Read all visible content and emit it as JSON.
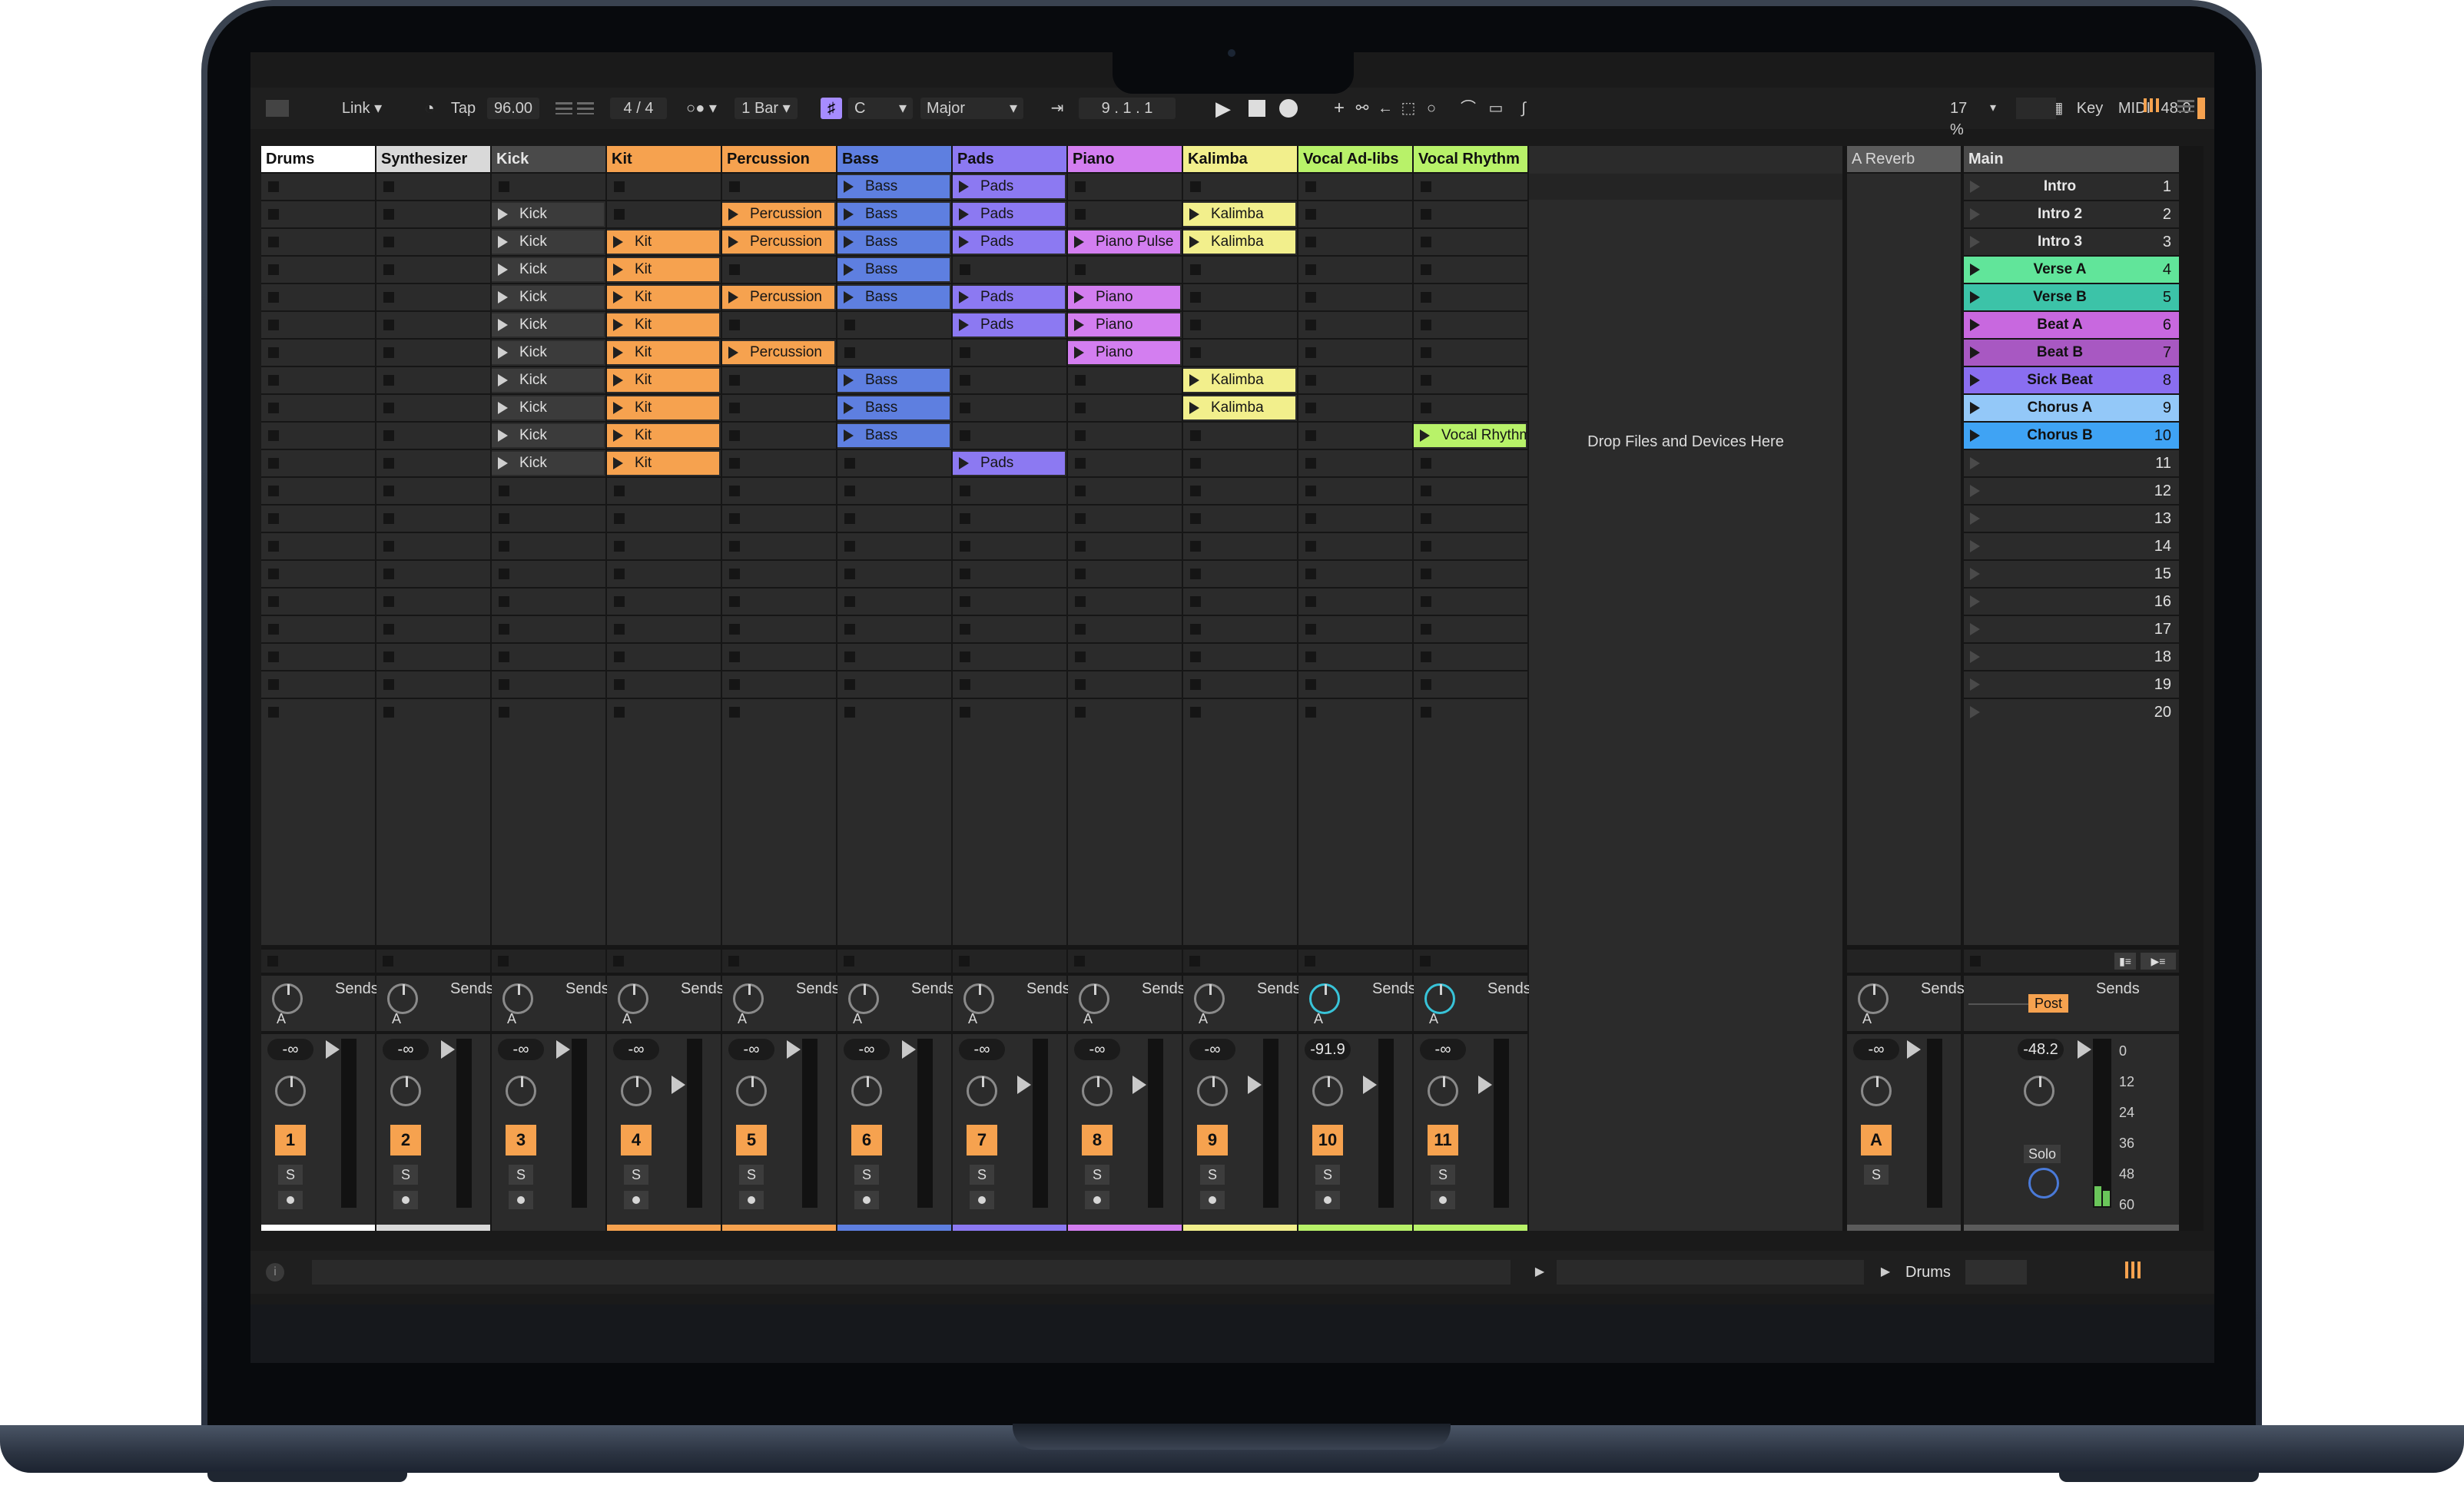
{
  "toolbar": {
    "link": "Link",
    "tap": "Tap",
    "tempo": "96.00",
    "signature": "4 / 4",
    "quantize": "1 Bar",
    "key_root": "C",
    "scale": "Major",
    "position": "9 .  1 .  1",
    "key_btn": "Key",
    "midi_btn": "MIDI",
    "sample_rate": "48.0",
    "cpu": "17 %",
    "cpu_fraction": 0.17
  },
  "colors": {
    "orange": "#f6a24f",
    "blue": "#5e7fe0",
    "purple": "#8c79f2",
    "magenta": "#d37ef0",
    "yellow": "#f2ef8c",
    "lime": "#b8f269"
  },
  "tracks": [
    {
      "name": "Drums",
      "color": "#ffffff",
      "num": "1",
      "vol": "-∞",
      "clips": []
    },
    {
      "name": "Synthesizer",
      "color": "#d9d9d9",
      "num": "2",
      "vol": "-∞",
      "clips": []
    },
    {
      "name": "Kick",
      "color": "#4a4a4a",
      "num": "3",
      "vol": "-∞",
      "clips": [
        null,
        "Kick",
        "Kick",
        "Kick",
        "Kick",
        "Kick",
        "Kick",
        "Kick",
        "Kick",
        "Kick",
        "Kick"
      ]
    },
    {
      "name": "Kit",
      "color": "#f6a24f",
      "num": "4",
      "vol": "-∞",
      "clips": [
        null,
        null,
        "Kit",
        "Kit",
        "Kit",
        "Kit",
        "Kit",
        "Kit",
        "Kit",
        "Kit",
        "Kit"
      ]
    },
    {
      "name": "Percussion",
      "color": "#f6a24f",
      "num": "5",
      "vol": "-∞",
      "clips": [
        null,
        "Percussion",
        "Percussion",
        null,
        "Percussion",
        null,
        "Percussion"
      ]
    },
    {
      "name": "Bass",
      "color": "#5e7fe0",
      "num": "6",
      "vol": "-∞",
      "clips": [
        "Bass",
        "Bass",
        "Bass",
        "Bass",
        "Bass",
        null,
        null,
        "Bass",
        "Bass",
        "Bass"
      ]
    },
    {
      "name": "Pads",
      "color": "#8c79f2",
      "num": "7",
      "vol": "-∞",
      "clips": [
        "Pads",
        "Pads",
        "Pads",
        null,
        "Pads",
        "Pads",
        null,
        null,
        null,
        null,
        "Pads"
      ]
    },
    {
      "name": "Piano",
      "color": "#d37ef0",
      "num": "8",
      "vol": "-∞",
      "clips": [
        null,
        null,
        "Piano Pulse",
        null,
        "Piano",
        "Piano",
        "Piano"
      ]
    },
    {
      "name": "Kalimba",
      "color": "#f2ef8c",
      "num": "9",
      "vol": "-∞",
      "clips": [
        null,
        "Kalimba",
        "Kalimba",
        null,
        null,
        null,
        null,
        "Kalimba",
        "Kalimba"
      ]
    },
    {
      "name": "Vocal Ad-libs",
      "color": "#b8f269",
      "num": "10",
      "vol": "-91.9",
      "clips": []
    },
    {
      "name": "Vocal Rhythm",
      "color": "#b8f269",
      "num": "11",
      "vol": "-∞",
      "clips": [
        null,
        null,
        null,
        null,
        null,
        null,
        null,
        null,
        null,
        "Vocal Rhythm"
      ]
    }
  ],
  "sends_label": "Sends",
  "send_letter": "A",
  "solo_letter": "S",
  "drop_zone": "Drop Files and Devices Here",
  "return_track": {
    "name": "A Reverb",
    "vol": "-∞",
    "num": "A"
  },
  "main_track": {
    "name": "Main",
    "vol": "-48.2",
    "post": "Post",
    "solo": "Solo",
    "meter_scale": [
      "0",
      "12",
      "24",
      "36",
      "48",
      "60"
    ]
  },
  "scenes": [
    {
      "name": "Intro",
      "num": "1",
      "color": null
    },
    {
      "name": "Intro 2",
      "num": "2",
      "color": null
    },
    {
      "name": "Intro 3",
      "num": "3",
      "color": null
    },
    {
      "name": "Verse A",
      "num": "4",
      "color": "#61e59a"
    },
    {
      "name": "Verse B",
      "num": "5",
      "color": "#3cc3a8"
    },
    {
      "name": "Beat A",
      "num": "6",
      "color": "#c868df"
    },
    {
      "name": "Beat B",
      "num": "7",
      "color": "#a858c2"
    },
    {
      "name": "Sick Beat",
      "num": "8",
      "color": "#8a6ef0"
    },
    {
      "name": "Chorus A",
      "num": "9",
      "color": "#93c8f8"
    },
    {
      "name": "Chorus B",
      "num": "10",
      "color": "#3fa3f4"
    },
    {
      "name": "",
      "num": "11",
      "color": null
    },
    {
      "name": "",
      "num": "12",
      "color": null
    },
    {
      "name": "",
      "num": "13",
      "color": null
    },
    {
      "name": "",
      "num": "14",
      "color": null
    },
    {
      "name": "",
      "num": "15",
      "color": null
    },
    {
      "name": "",
      "num": "16",
      "color": null
    },
    {
      "name": "",
      "num": "17",
      "color": null
    },
    {
      "name": "",
      "num": "18",
      "color": null
    },
    {
      "name": "",
      "num": "19",
      "color": null
    },
    {
      "name": "",
      "num": "20",
      "color": null
    }
  ],
  "statusbar": {
    "selected_track": "Drums"
  }
}
